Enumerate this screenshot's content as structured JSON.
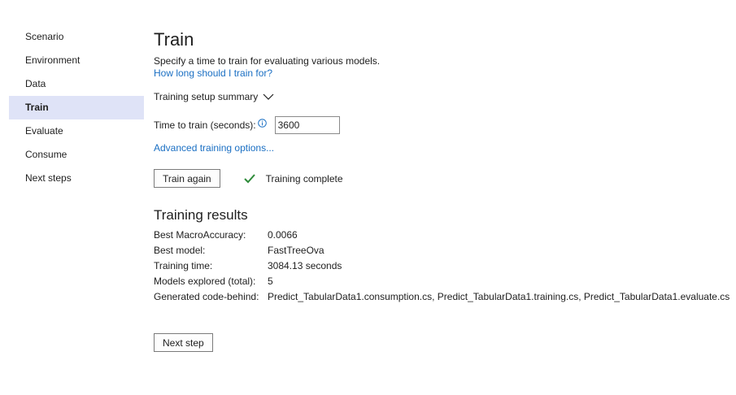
{
  "sidebar": {
    "items": [
      {
        "label": "Scenario",
        "active": false
      },
      {
        "label": "Environment",
        "active": false
      },
      {
        "label": "Data",
        "active": false
      },
      {
        "label": "Train",
        "active": true
      },
      {
        "label": "Evaluate",
        "active": false
      },
      {
        "label": "Consume",
        "active": false
      },
      {
        "label": "Next steps",
        "active": false
      }
    ]
  },
  "main": {
    "title": "Train",
    "subtitle": "Specify a time to train for evaluating various models.",
    "help_link": "How long should I train for?",
    "summary_label": "Training setup summary",
    "time_label": "Time to train (seconds):",
    "time_value": "3600",
    "advanced_link": "Advanced training options...",
    "train_again_label": "Train again",
    "status_text": "Training complete",
    "results_title": "Training results",
    "results": [
      {
        "key": "Best MacroAccuracy:",
        "value": "0.0066"
      },
      {
        "key": "Best model:",
        "value": "FastTreeOva"
      },
      {
        "key": "Training time:",
        "value": "3084.13 seconds"
      },
      {
        "key": "Models explored (total):",
        "value": "5"
      },
      {
        "key": "Generated code-behind:",
        "value": "Predict_TabularData1.consumption.cs, Predict_TabularData1.training.cs, Predict_TabularData1.evaluate.cs"
      }
    ],
    "next_step_label": "Next step"
  },
  "colors": {
    "accent_link": "#1a6fc3",
    "active_nav_bg": "#dfe3f7",
    "success_check": "#2e8b3a"
  },
  "icons": {
    "summary_toggle": "chevron-down-icon",
    "info": "info-icon",
    "status": "checkmark-icon"
  }
}
